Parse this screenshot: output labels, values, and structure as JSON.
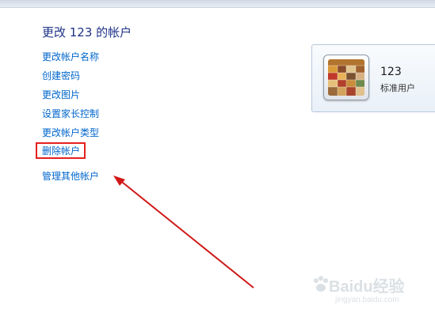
{
  "page": {
    "title": "更改 123 的帐户"
  },
  "tasks": [
    {
      "label": "更改帐户名称"
    },
    {
      "label": "创建密码"
    },
    {
      "label": "更改图片"
    },
    {
      "label": "设置家长控制"
    },
    {
      "label": "更改帐户类型"
    },
    {
      "label": "删除帐户"
    }
  ],
  "other": {
    "manage_label": "管理其他帐户"
  },
  "user": {
    "name": "123",
    "type": "标准用户",
    "avatar_icon": "colorful-tiles-picture"
  },
  "annotation": {
    "highlight_color": "#e52020",
    "highlight_target": "删除帐户",
    "arrow_color": "#d01818"
  },
  "watermark": {
    "brand": "Baidu经验",
    "url": "jingyan.baidu.com"
  }
}
